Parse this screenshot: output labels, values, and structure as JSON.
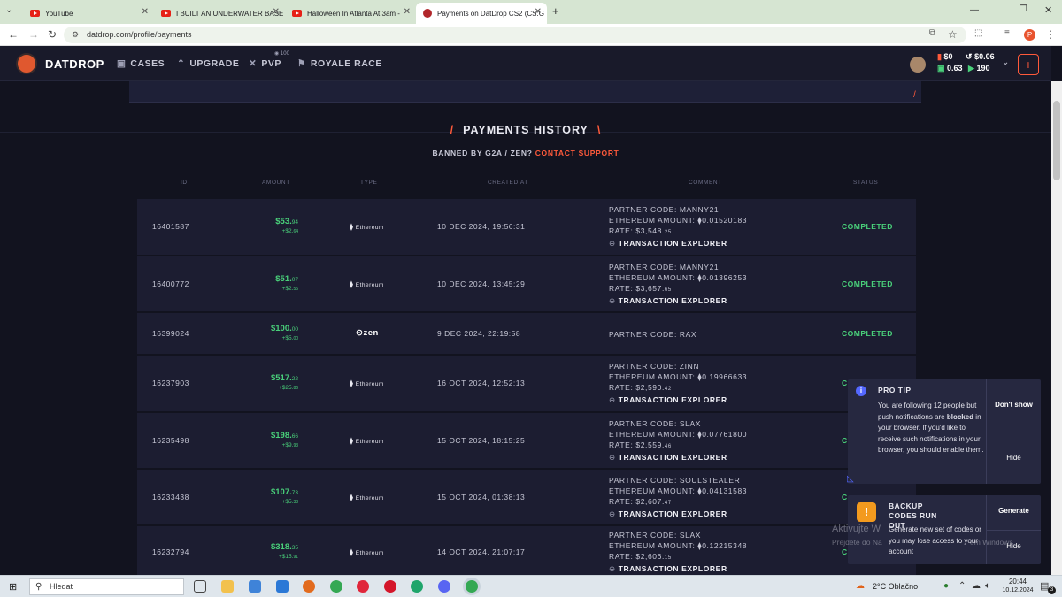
{
  "tabs": [
    {
      "title": "YouTube",
      "icon": "youtube-icon"
    },
    {
      "title": "I BUILT AN UNDERWATER BASE",
      "icon": "youtube-icon"
    },
    {
      "title": "Halloween In Atlanta At 3am -",
      "icon": "youtube-icon"
    },
    {
      "title": "Payments on DatDrop CS2 (CS:G",
      "icon": "datdrop-icon"
    }
  ],
  "url": "datdrop.com/profile/payments",
  "site": {
    "brand": "DATDROP",
    "nav": {
      "cases": "CASES",
      "upgrade": "UPGRADE",
      "pvp": "PVP",
      "pvp_badge": "100",
      "royale": "ROYALE RACE"
    },
    "balance": {
      "main": "$0",
      "main2": "$0.06",
      "sub1": "0.63",
      "sub2": "190"
    }
  },
  "payments": {
    "title": "PAYMENTS HISTORY",
    "banned_prefix": "BANNED BY G2A / ZEN?",
    "contact": "CONTACT SUPPORT",
    "columns": {
      "id": "ID",
      "amount": "AMOUNT",
      "type": "TYPE",
      "created": "CREATED AT",
      "comment": "COMMENT",
      "status": "STATUS"
    },
    "rows": [
      {
        "id": "16401587",
        "amount": "$53.",
        "amount_cents": "94",
        "bonus": "+$2.",
        "bonus_cents": "64",
        "type": "Ethereum",
        "created": "10 DEC 2024, 19:56:31",
        "partner": "PARTNER CODE: MANNY21",
        "eth": "ETHEREUM AMOUNT: ⧫0.01520183",
        "rate": "RATE: $3,548.",
        "rate_cents": "25",
        "explorer": "TRANSACTION EXPLORER",
        "status": "COMPLETED"
      },
      {
        "id": "16400772",
        "amount": "$51.",
        "amount_cents": "07",
        "bonus": "+$2.",
        "bonus_cents": "55",
        "type": "Ethereum",
        "created": "10 DEC 2024, 13:45:29",
        "partner": "PARTNER CODE: MANNY21",
        "eth": "ETHEREUM AMOUNT: ⧫0.01396253",
        "rate": "RATE: $3,657.",
        "rate_cents": "65",
        "explorer": "TRANSACTION EXPLORER",
        "status": "COMPLETED"
      },
      {
        "id": "16399024",
        "amount": "$100.",
        "amount_cents": "00",
        "bonus": "+$5.",
        "bonus_cents": "00",
        "type": "zen",
        "created": "9 DEC 2024, 22:19:58",
        "partner": "PARTNER CODE: RAX",
        "status": "COMPLETED"
      },
      {
        "id": "16237903",
        "amount": "$517.",
        "amount_cents": "22",
        "bonus": "+$25.",
        "bonus_cents": "86",
        "type": "Ethereum",
        "created": "16 OCT 2024, 12:52:13",
        "partner": "PARTNER CODE: ZINN",
        "eth": "ETHEREUM AMOUNT: ⧫0.19966633",
        "rate": "RATE: $2,590.",
        "rate_cents": "42",
        "explorer": "TRANSACTION EXPLORER",
        "status": "CO"
      },
      {
        "id": "16235498",
        "amount": "$198.",
        "amount_cents": "66",
        "bonus": "+$9.",
        "bonus_cents": "93",
        "type": "Ethereum",
        "created": "15 OCT 2024, 18:15:25",
        "partner": "PARTNER CODE: SLAX",
        "eth": "ETHEREUM AMOUNT: ⧫0.07761800",
        "rate": "RATE: $2,559.",
        "rate_cents": "46",
        "explorer": "TRANSACTION EXPLORER",
        "status": "C"
      },
      {
        "id": "16233438",
        "amount": "$107.",
        "amount_cents": "73",
        "bonus": "+$5.",
        "bonus_cents": "38",
        "type": "Ethereum",
        "created": "15 OCT 2024, 01:38:13",
        "partner": "PARTNER CODE: SOULSTEALER",
        "eth": "ETHEREUM AMOUNT: ⧫0.04131583",
        "rate": "RATE: $2,607.",
        "rate_cents": "47",
        "explorer": "TRANSACTION EXPLORER",
        "status": "C"
      },
      {
        "id": "16232794",
        "amount": "$318.",
        "amount_cents": "35",
        "bonus": "+$15.",
        "bonus_cents": "91",
        "type": "Ethereum",
        "created": "14 OCT 2024, 21:07:17",
        "partner": "PARTNER CODE: SLAX",
        "eth": "ETHEREUM AMOUNT: ⧫0.12215348",
        "rate": "RATE: $2,606.",
        "rate_cents": "15",
        "explorer": "TRANSACTION EXPLORER",
        "status": "CO"
      }
    ]
  },
  "protip": {
    "title": "PRO TIP",
    "text_a": "You are following 12 people but push notifications are ",
    "text_b": "blocked",
    "text_c": " in your browser. If you'd like to receive such notifications in your browser, you should enable them.",
    "dont_show": "Don't show",
    "hide": "Hide"
  },
  "backup": {
    "title": "BACKUP CODES RUN OUT",
    "text": "Generate new set of codes or you may lose access to your account",
    "generate": "Generate",
    "hide": "Hide"
  },
  "watermark": {
    "line1": "Aktivujte W",
    "line2": "Přejděte do Na",
    "line3": "ém Windows."
  },
  "taskbar": {
    "search": "Hledat",
    "weather": "2°C  Oblačno",
    "time": "20:44",
    "date": "10.12.2024",
    "notif": "3"
  }
}
